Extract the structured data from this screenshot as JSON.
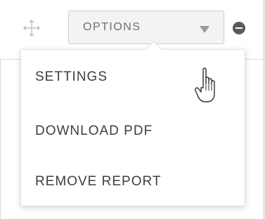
{
  "toolbar": {
    "options_label": "OPTIONS"
  },
  "menu": {
    "items": [
      {
        "label": "SETTINGS"
      },
      {
        "label": "DOWNLOAD PDF"
      },
      {
        "label": "REMOVE REPORT"
      }
    ]
  },
  "icons": {
    "move": "move-icon",
    "caret": "caret-down-icon",
    "remove": "minus-circle-icon",
    "cursor": "hand-pointer-icon"
  },
  "colors": {
    "text": "#3e3e3e",
    "select_bg": "#f3f3f3",
    "remove_icon": "#5a5a5a"
  }
}
